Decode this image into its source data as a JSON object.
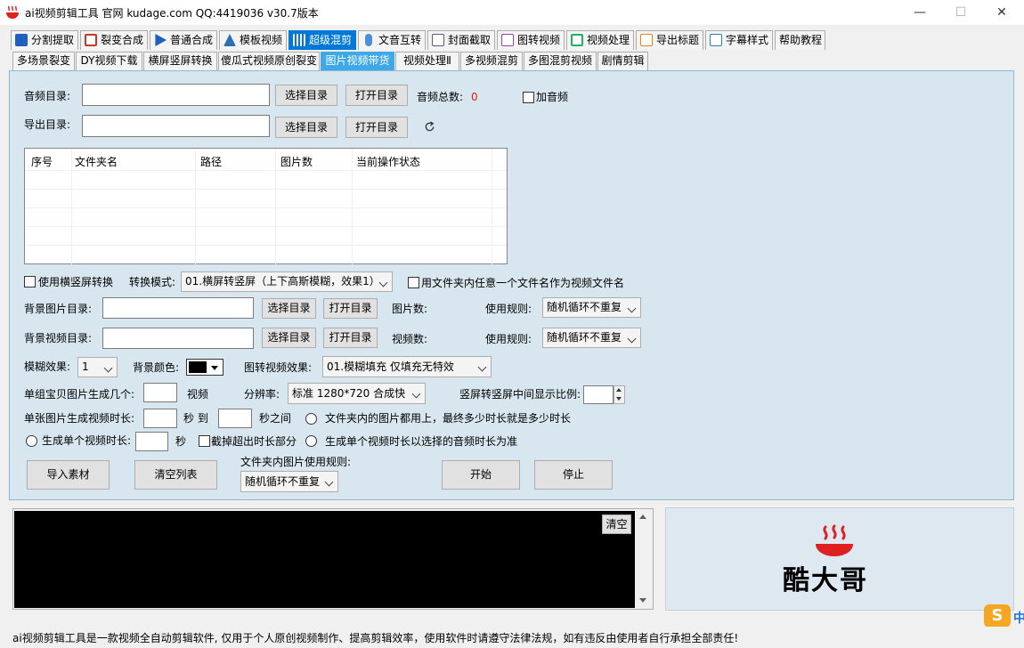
{
  "window": {
    "title": "ai视频剪辑工具 官网 kudage.com QQ:4419036   v30.7版本",
    "minimize": "—",
    "maximize": "☐",
    "close": "✕"
  },
  "main_tabs": [
    {
      "label": "分割提取",
      "icon": "split-icon",
      "color": "#1f5fbf"
    },
    {
      "label": "裂变合成",
      "icon": "merge-icon",
      "color": "#c0392b"
    },
    {
      "label": "普通合成",
      "icon": "play-icon",
      "color": "#1f5fbf"
    },
    {
      "label": "模板视频",
      "icon": "template-icon",
      "color": "#2c6fb5"
    },
    {
      "label": "超级混剪",
      "icon": "waveform-icon",
      "color": "#ffffff"
    },
    {
      "label": "文音互转",
      "icon": "microphone-icon",
      "color": "#4a90d9"
    },
    {
      "label": "封面截取",
      "icon": "image-icon",
      "color": "#5a5a8a"
    },
    {
      "label": "图转视频",
      "icon": "slideshow-icon",
      "color": "#8e44ad"
    },
    {
      "label": "视频处理",
      "icon": "video-process-icon",
      "color": "#27ae60"
    },
    {
      "label": "导出标题",
      "icon": "export-title-icon",
      "color": "#e67e22"
    },
    {
      "label": "字幕样式",
      "icon": "subtitle-icon",
      "color": "#2980b9"
    },
    {
      "label": "帮助教程",
      "icon": "",
      "color": ""
    }
  ],
  "sub_tabs": [
    "多场景裂变",
    "DY视频下载",
    "横屏竖屏转换",
    "傻瓜式视频原创裂变",
    "图片视频带货",
    "视频处理Ⅱ",
    "多视频混剪",
    "多图混剪视频",
    "剧情剪辑"
  ],
  "form": {
    "audio_dir_label": "音频目录:",
    "export_dir_label": "导出目录:",
    "select_dir": "选择目录",
    "open_dir": "打开目录",
    "audio_total_label": "音频总数:",
    "audio_total_value": "0",
    "add_audio": "加音频",
    "use_hv_convert": "使用横竖屏转换",
    "convert_mode_label": "转换模式:",
    "convert_mode_value": "01.横屏转竖屏（上下高斯模糊，效果1）",
    "use_filename": "用文件夹内任意一个文件名作为视频文件名",
    "bg_image_dir": "背景图片目录:",
    "bg_video_dir": "背景视频目录:",
    "image_count": "图片数:",
    "video_count": "视频数:",
    "use_rule": "使用规则:",
    "rule_value": "随机循环不重复",
    "blur_label": "模糊效果:",
    "blur_value": "1",
    "bg_color_label": "背景颜色:",
    "img2video_effect_label": "图转视频效果:",
    "img2video_effect_value": "01.模糊填充 仅填充无特效",
    "per_group_label": "单组宝贝图片生成几个:",
    "video_unit": "视频",
    "resolution_label": "分辨率:",
    "resolution_value": "标准 1280*720 合成快",
    "ratio_label": "竖屏转竖屏中间显示比例:",
    "per_image_duration_label": "单张图片生成视频时长:",
    "sec_to": "秒 到",
    "sec_between": "秒之间",
    "all_images_opt": "文件夹内的图片都用上，最终多少时长就是多少时长",
    "single_duration_opt": "生成单个视频时长:",
    "sec": "秒",
    "cut_excess": "截掉超出时长部分",
    "audio_duration_opt": "生成单个视频时长以选择的音频时长为准",
    "folder_rule_label": "文件夹内图片使用规则:",
    "folder_rule_value": "随机循环不重复",
    "import_btn": "导入素材",
    "clear_list_btn": "清空列表",
    "start_btn": "开始",
    "stop_btn": "停止"
  },
  "table": {
    "columns": [
      "序号",
      "文件夹名",
      "路径",
      "图片数",
      "当前操作状态"
    ]
  },
  "log": {
    "clear": "清空"
  },
  "logo": {
    "text": "酷大哥"
  },
  "status": "ai视频剪辑工具是一款视频全自动剪辑软件, 仅用于个人原创视频制作、提高剪辑效率，使用软件时请遵守法律法规，如有违反由使用者自行承担全部责任!",
  "ime": {
    "label": "中"
  }
}
